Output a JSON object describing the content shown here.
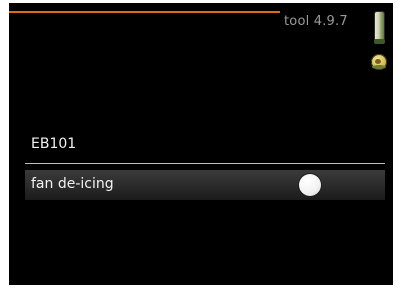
{
  "header": {
    "tool_title": "tool 4.9.7"
  },
  "section": {
    "title": "EB101"
  },
  "rows": [
    {
      "label": "fan de-icing",
      "toggle_state": "off"
    }
  ],
  "icons": {
    "side": "thermometer-icon",
    "status": "globe-icon"
  },
  "colors": {
    "accent": "#e06a12",
    "background": "#000000",
    "text": "#f2f2f2",
    "title_text": "#9a9a9a"
  }
}
